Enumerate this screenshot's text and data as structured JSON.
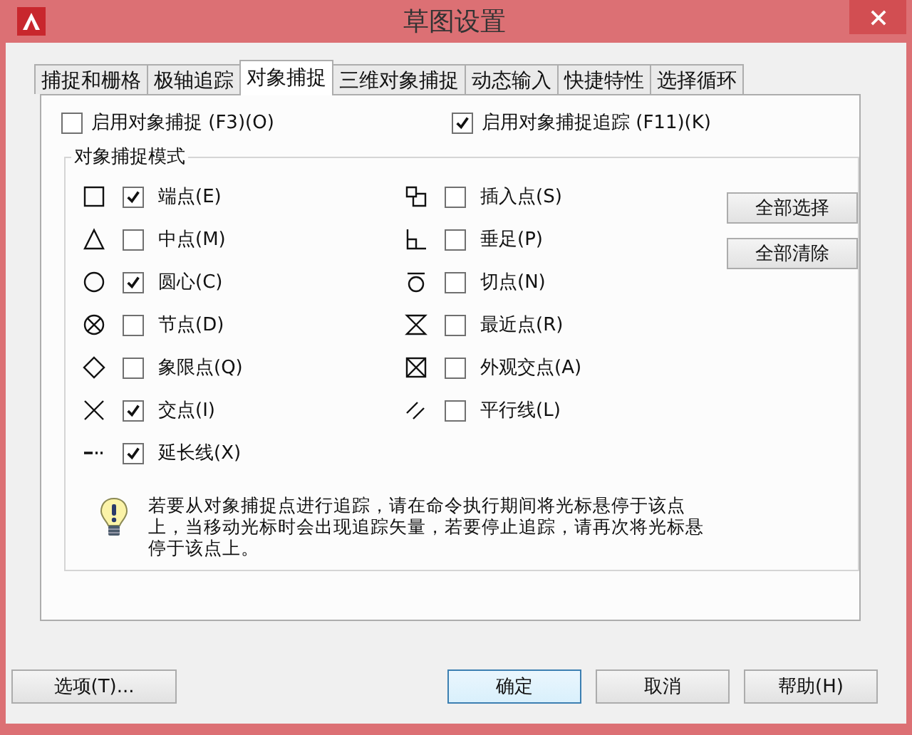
{
  "window": {
    "title": "草图设置"
  },
  "tabs": [
    {
      "label": "捕捉和栅格",
      "selected": false
    },
    {
      "label": "极轴追踪",
      "selected": false
    },
    {
      "label": "对象捕捉",
      "selected": true
    },
    {
      "label": "三维对象捕捉",
      "selected": false
    },
    {
      "label": "动态输入",
      "selected": false
    },
    {
      "label": "快捷特性",
      "selected": false
    },
    {
      "label": "选择循环",
      "selected": false
    }
  ],
  "toggles": [
    {
      "label": "启用对象捕捉 (F3)(O)",
      "checked": false
    },
    {
      "label": "启用对象捕捉追踪 (F11)(K)",
      "checked": true
    }
  ],
  "snap_modes": {
    "title": "对象捕捉模式",
    "left": [
      {
        "kind": "square",
        "label": "端点(E)",
        "checked": true
      },
      {
        "kind": "triangle",
        "label": "中点(M)",
        "checked": false
      },
      {
        "kind": "circle",
        "label": "圆心(C)",
        "checked": true
      },
      {
        "kind": "circle-x",
        "label": "节点(D)",
        "checked": false
      },
      {
        "kind": "diamond",
        "label": "象限点(Q)",
        "checked": false
      },
      {
        "kind": "cross",
        "label": "交点(I)",
        "checked": true
      },
      {
        "kind": "extension",
        "label": "延长线(X)",
        "checked": true
      }
    ],
    "right": [
      {
        "kind": "insertion",
        "label": "插入点(S)",
        "checked": false
      },
      {
        "kind": "perpendicular",
        "label": "垂足(P)",
        "checked": false
      },
      {
        "kind": "tangent",
        "label": "切点(N)",
        "checked": false
      },
      {
        "kind": "nearest",
        "label": "最近点(R)",
        "checked": false
      },
      {
        "kind": "square-x",
        "label": "外观交点(A)",
        "checked": false
      },
      {
        "kind": "parallel",
        "label": "平行线(L)",
        "checked": false
      }
    ],
    "buttons": [
      "全部选择",
      "全部清除"
    ],
    "tip": "若要从对象捕捉点进行追踪，请在命令执行期间将光标悬停于该点上，当移动光标时会出现追踪矢量，若要停止追踪，请再次将光标悬停于该点上。"
  },
  "footer": {
    "options": "选项(T)...",
    "buttons": [
      {
        "label": "确定",
        "default": true
      },
      {
        "label": "取消",
        "default": false
      },
      {
        "label": "帮助(H)",
        "default": false
      }
    ]
  }
}
